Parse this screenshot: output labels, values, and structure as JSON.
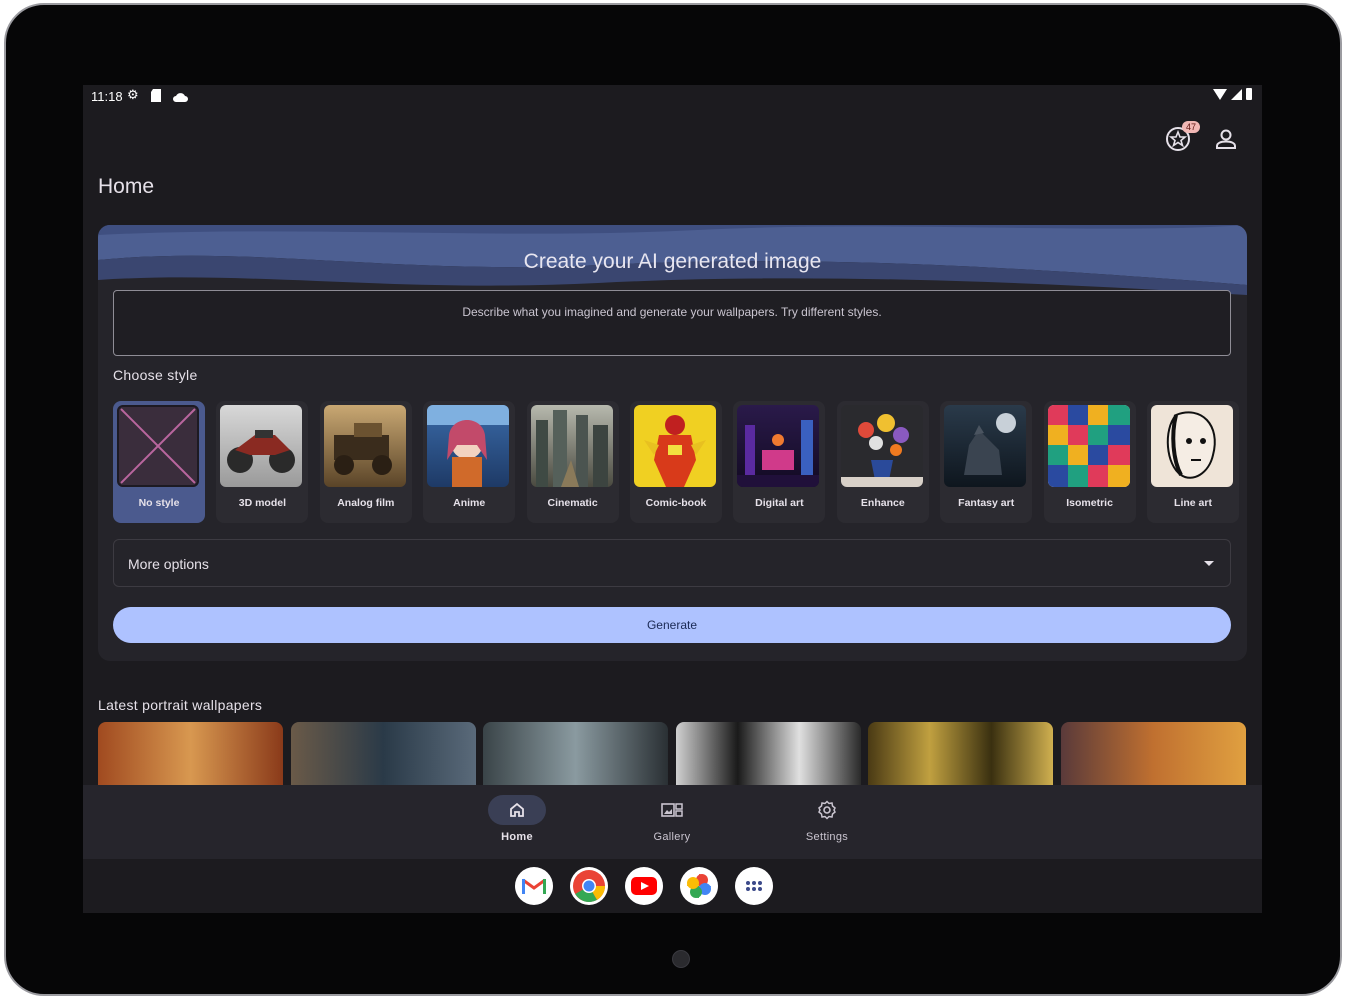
{
  "status_bar": {
    "time": "11:18"
  },
  "header": {
    "notification_count": "47"
  },
  "page": {
    "title": "Home"
  },
  "create_card": {
    "title": "Create your AI generated image",
    "prompt_placeholder": "Describe what you imagined and generate your wallpapers. Try different styles.",
    "choose_style_label": "Choose style",
    "styles": [
      {
        "label": "No style",
        "selected": true
      },
      {
        "label": "3D model"
      },
      {
        "label": "Analog film"
      },
      {
        "label": "Anime"
      },
      {
        "label": "Cinematic"
      },
      {
        "label": "Comic-book"
      },
      {
        "label": "Digital art"
      },
      {
        "label": "Enhance"
      },
      {
        "label": "Fantasy art"
      },
      {
        "label": "Isometric"
      },
      {
        "label": "Line art"
      }
    ],
    "more_options_label": "More options",
    "generate_label": "Generate"
  },
  "latest": {
    "title": "Latest portrait wallpapers"
  },
  "bottom_nav": {
    "items": [
      {
        "label": "Home",
        "icon": "home-icon",
        "active": true
      },
      {
        "label": "Gallery",
        "icon": "gallery-icon"
      },
      {
        "label": "Settings",
        "icon": "settings-icon"
      }
    ]
  },
  "dock": {
    "apps": [
      "gmail-icon",
      "chrome-icon",
      "youtube-icon",
      "photos-icon",
      "app-drawer-icon"
    ]
  },
  "colors": {
    "background": "#1c1b1f",
    "card": "#25242a",
    "accent": "#aec2ff",
    "selected_style": "#4b5a8e",
    "badge": "#f2b8b5"
  }
}
